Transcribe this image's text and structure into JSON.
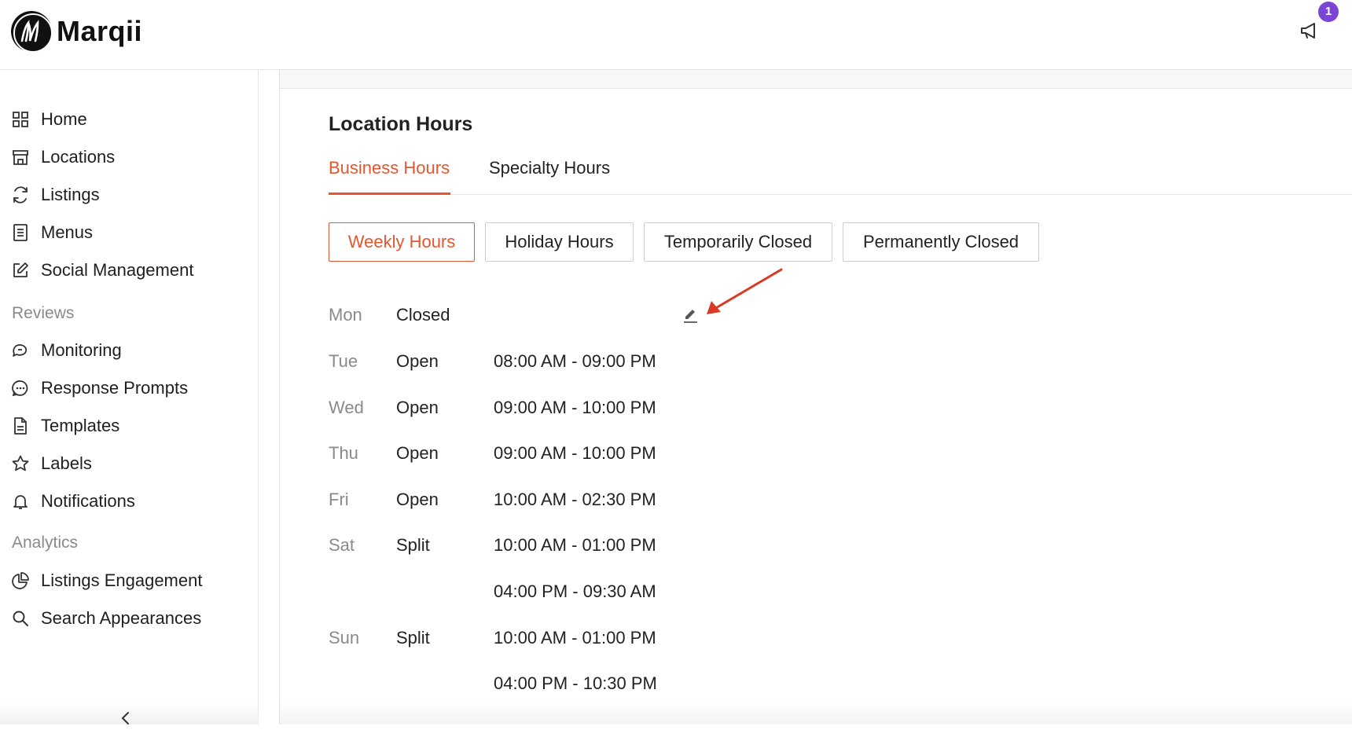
{
  "app": {
    "brand_name": "Marqii",
    "notification_count": "1"
  },
  "sidebar": {
    "items_top": [
      {
        "label": "Home",
        "icon": "grid-icon"
      },
      {
        "label": "Locations",
        "icon": "storefront-icon"
      },
      {
        "label": "Listings",
        "icon": "refresh-icon"
      },
      {
        "label": "Menus",
        "icon": "menu-doc-icon"
      },
      {
        "label": "Social Management",
        "icon": "edit-square-icon"
      }
    ],
    "reviews_label": "Reviews",
    "items_reviews": [
      {
        "label": "Monitoring",
        "icon": "chat-bubbles-icon"
      },
      {
        "label": "Response Prompts",
        "icon": "chat-dots-icon"
      },
      {
        "label": "Templates",
        "icon": "document-icon"
      },
      {
        "label": "Labels",
        "icon": "star-icon"
      },
      {
        "label": "Notifications",
        "icon": "bell-icon"
      }
    ],
    "analytics_label": "Analytics",
    "items_analytics": [
      {
        "label": "Listings Engagement",
        "icon": "pie-chart-icon"
      },
      {
        "label": "Search Appearances",
        "icon": "search-icon"
      }
    ]
  },
  "main": {
    "title": "Location Hours",
    "tabs": [
      {
        "label": "Business Hours",
        "active": true
      },
      {
        "label": "Specialty Hours",
        "active": false
      }
    ],
    "segments": [
      {
        "label": "Weekly Hours",
        "active": true
      },
      {
        "label": "Holiday Hours",
        "active": false
      },
      {
        "label": "Temporarily Closed",
        "active": false
      },
      {
        "label": "Permanently Closed",
        "active": false
      }
    ],
    "hours": [
      {
        "day": "Mon",
        "status": "Closed",
        "time": ""
      },
      {
        "day": "Tue",
        "status": "Open",
        "time": "08:00 AM - 09:00 PM"
      },
      {
        "day": "Wed",
        "status": "Open",
        "time": "09:00 AM - 10:00 PM"
      },
      {
        "day": "Thu",
        "status": "Open",
        "time": "09:00 AM - 10:00 PM"
      },
      {
        "day": "Fri",
        "status": "Open",
        "time": "10:00 AM - 02:30 PM"
      },
      {
        "day": "Sat",
        "status": "Split",
        "time": "10:00 AM - 01:00 PM"
      },
      {
        "day": "",
        "status": "",
        "time": "04:00 PM - 09:30 AM"
      },
      {
        "day": "Sun",
        "status": "Split",
        "time": "10:00 AM - 01:00 PM"
      },
      {
        "day": "",
        "status": "",
        "time": "04:00 PM - 10:30 PM"
      }
    ]
  },
  "colors": {
    "accent": "#e2572f",
    "badge": "#7b46d6",
    "muted": "#8a8a8a",
    "annotation_arrow": "#d93a26"
  }
}
